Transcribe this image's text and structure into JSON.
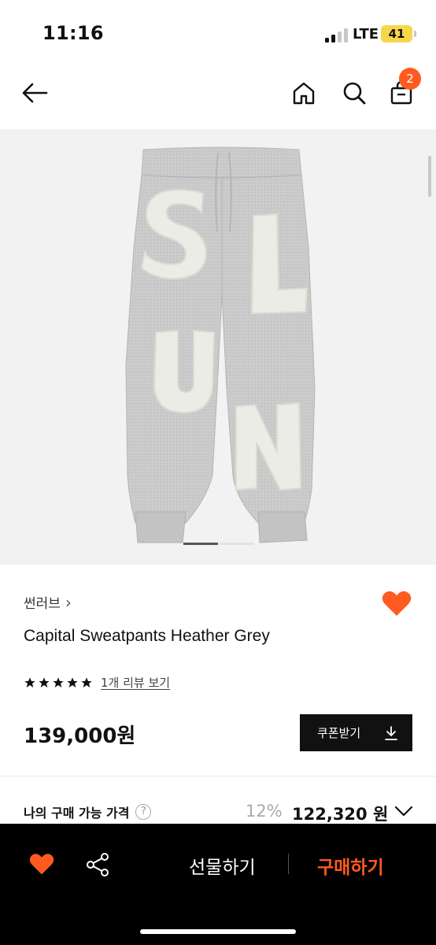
{
  "status_bar": {
    "time": "11:16",
    "network": "LTE",
    "battery": "41"
  },
  "nav": {
    "cart_count": "2"
  },
  "product": {
    "brand": "썬러브",
    "brand_chevron": "›",
    "name": "Capital Sweatpants Heather Grey",
    "rating_stars": 5,
    "review_link": "1개 리뷰 보기",
    "price": "139,000원",
    "coupon_label": "쿠폰받기",
    "image_letters": [
      "S",
      "L",
      "U",
      "N"
    ],
    "carousel_position": "1 of 3"
  },
  "my_price": {
    "label": "나의 구매 가능 가격",
    "help": "?",
    "discount": "12%",
    "price": "122,320 원"
  },
  "bottom_bar": {
    "gift_label": "선물하기",
    "buy_label": "구매하기"
  },
  "colors": {
    "accent": "#ff5a1f",
    "dark": "#111111",
    "image_bg": "#f2f2f2",
    "pants_grey": "#c9c9c9"
  }
}
